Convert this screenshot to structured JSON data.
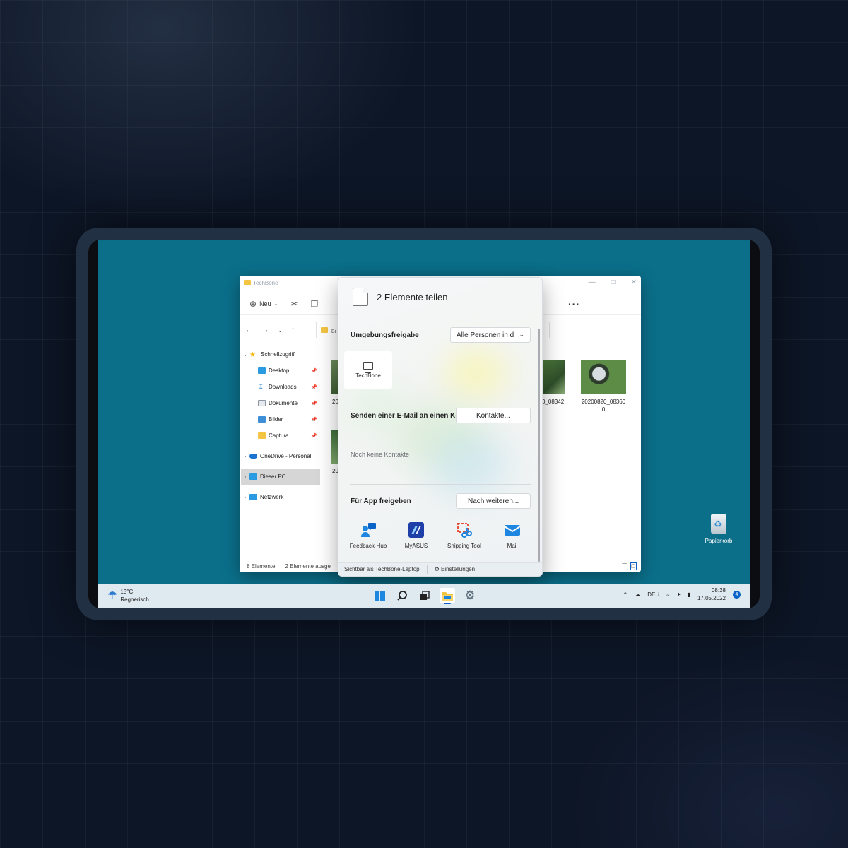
{
  "explorer": {
    "title": "TechBone",
    "toolbar": {
      "new_label": "Neu"
    },
    "address_text": "Bi",
    "sidebar": [
      {
        "label": "Schnellzugriff",
        "icon": "star-icon",
        "indent": 1,
        "chevron": "v",
        "pinned": false
      },
      {
        "label": "Desktop",
        "icon": "desktop-icon",
        "indent": 2,
        "chevron": "",
        "pinned": true
      },
      {
        "label": "Downloads",
        "icon": "download-icon",
        "indent": 2,
        "chevron": "",
        "pinned": true
      },
      {
        "label": "Dokumente",
        "icon": "document-icon",
        "indent": 2,
        "chevron": "",
        "pinned": true
      },
      {
        "label": "Bilder",
        "icon": "pictures-icon",
        "indent": 2,
        "chevron": "",
        "pinned": true
      },
      {
        "label": "Captura",
        "icon": "folder-icon",
        "indent": 2,
        "chevron": "",
        "pinned": true
      },
      {
        "label": "OneDrive - Personal",
        "icon": "onedrive-icon",
        "indent": 1,
        "chevron": ">",
        "pinned": false
      },
      {
        "label": "Dieser PC",
        "icon": "pc-icon",
        "indent": 1,
        "chevron": ">",
        "pinned": false
      },
      {
        "label": "Netzwerk",
        "icon": "network-icon",
        "indent": 1,
        "chevron": ">",
        "pinned": false
      }
    ],
    "files": {
      "partial_1": "20",
      "partial_2": "20",
      "file_a": "0_08342",
      "file_b_line1": "20200820_08360",
      "file_b_line2": "0"
    },
    "status": {
      "count": "8 Elemente",
      "selected": "2 Elemente ausge"
    }
  },
  "share": {
    "title": "2 Elemente teilen",
    "nearby_label": "Umgebungsfreigabe",
    "nearby_select": "Alle Personen in d",
    "device_name": "TechBone",
    "email_label": "Senden einer E-Mail an einen Kontakt",
    "contacts_button": "Kontakte...",
    "no_contacts": "Noch keine Kontakte",
    "app_label": "Für App freigeben",
    "more_button": "Nach weiteren...",
    "apps": [
      {
        "name": "Feedback-Hub",
        "icon": "feedback-hub-icon"
      },
      {
        "name": "MyASUS",
        "icon": "myasus-icon"
      },
      {
        "name": "Snipping Tool",
        "icon": "snipping-tool-icon"
      },
      {
        "name": "Mail",
        "icon": "mail-icon"
      }
    ],
    "footer_visible": "Sichtbar als TechBone-Laptop",
    "footer_settings": "Einstellungen"
  },
  "desktop": {
    "recycle_bin": "Papierkorb"
  },
  "taskbar": {
    "weather_temp": "13°C",
    "weather_desc": "Regnerisch",
    "language": "DEU",
    "time": "08:38",
    "date": "17.05.2022",
    "notifications": "4"
  },
  "colors": {
    "desktop_bg": "#0b6f8a",
    "accent": "#0a64c7"
  }
}
